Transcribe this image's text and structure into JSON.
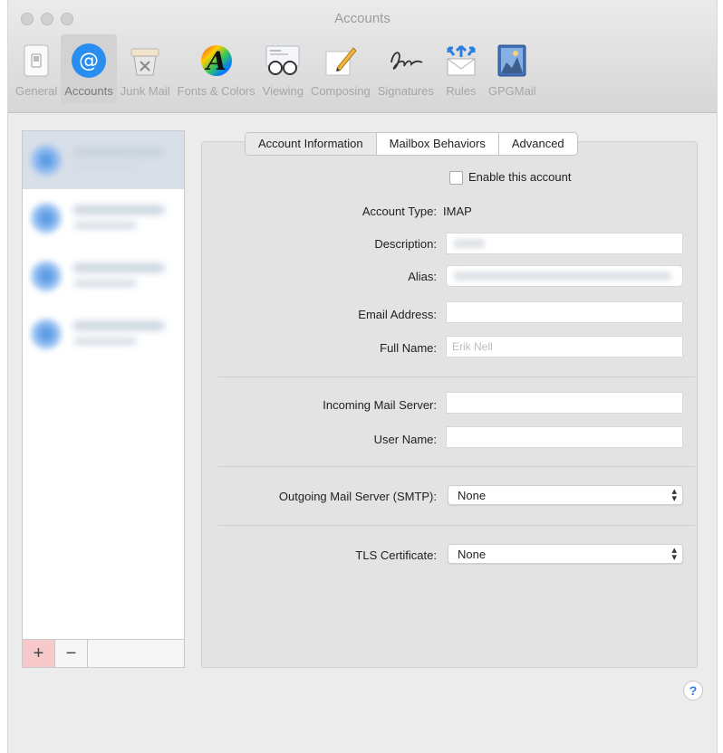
{
  "window": {
    "title": "Accounts"
  },
  "toolbar": {
    "items": [
      {
        "label": "General",
        "icon": "switch-icon"
      },
      {
        "label": "Accounts",
        "icon": "at-icon"
      },
      {
        "label": "Junk Mail",
        "icon": "trash-icon"
      },
      {
        "label": "Fonts & Colors",
        "icon": "font-icon"
      },
      {
        "label": "Viewing",
        "icon": "glasses-icon"
      },
      {
        "label": "Composing",
        "icon": "pencil-icon"
      },
      {
        "label": "Signatures",
        "icon": "signature-icon"
      },
      {
        "label": "Rules",
        "icon": "rules-icon"
      },
      {
        "label": "GPGMail",
        "icon": "gpgmail-icon"
      }
    ],
    "selected": "Accounts"
  },
  "sidebar": {
    "add_label": "+",
    "remove_label": "−"
  },
  "tabs": [
    "Account Information",
    "Mailbox Behaviors",
    "Advanced"
  ],
  "form": {
    "enable_label": "Enable this account",
    "account_type_label": "Account Type:",
    "account_type_value": "IMAP",
    "description_label": "Description:",
    "alias_label": "Alias:",
    "email_label": "Email Address:",
    "fullname_label": "Full Name:",
    "fullname_placeholder": "Erik Nell",
    "incoming_label": "Incoming Mail Server:",
    "username_label": "User Name:",
    "outgoing_label": "Outgoing Mail Server (SMTP):",
    "outgoing_value": "None",
    "tls_label": "TLS Certificate:",
    "tls_value": "None"
  },
  "help": {
    "label": "?"
  },
  "colors": {
    "accent": "#2f7de1",
    "add_button": "#f7c9cb"
  }
}
